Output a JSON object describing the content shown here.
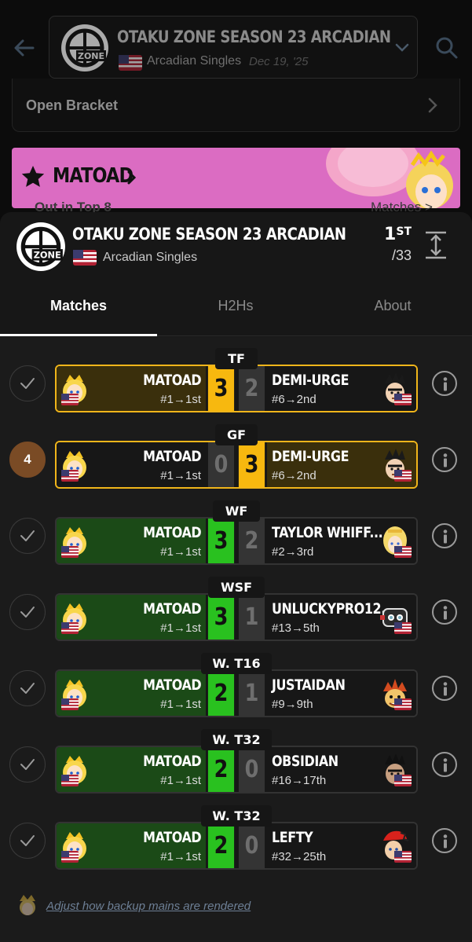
{
  "background_screen": {
    "event_title": "OTAKU ZONE SEASON 23 ARCADIAN",
    "event_subtitle": "Arcadian Singles",
    "event_date": "Dec 19, '25",
    "open_bracket_label": "Open Bracket",
    "player_banner_name": "MATOAD",
    "ghost_left": "Out in Top 8",
    "ghost_right": "Matches >"
  },
  "sheet": {
    "title": "OTAKU ZONE SEASON 23 ARCADIAN",
    "subtitle": "Arcadian Singles",
    "placement": "1",
    "placement_suffix": "ST",
    "placement_total": "/33"
  },
  "tabs": [
    {
      "label": "Matches",
      "active": true
    },
    {
      "label": "H2Hs",
      "active": false
    },
    {
      "label": "About",
      "active": false
    }
  ],
  "matches": [
    {
      "round": "TF",
      "status": "done",
      "left_name": "MATOAD",
      "left_seed": "#1→1st",
      "left_score": "3",
      "right_name": "DEMI-URGE",
      "right_seed": "#6→2nd",
      "right_score": "2",
      "winner": "left",
      "style": "gold"
    },
    {
      "round": "GF",
      "status": "4",
      "left_name": "MATOAD",
      "left_seed": "#1→1st",
      "left_score": "0",
      "right_name": "DEMI-URGE",
      "right_seed": "#6→2nd",
      "right_score": "3",
      "winner": "right",
      "style": "gold"
    },
    {
      "round": "WF",
      "status": "done",
      "left_name": "MATOAD",
      "left_seed": "#1→1st",
      "left_score": "3",
      "right_name": "TAYLOR WHIFF...",
      "right_seed": "#2→3rd",
      "right_score": "2",
      "winner": "left",
      "style": "green"
    },
    {
      "round": "WSF",
      "status": "done",
      "left_name": "MATOAD",
      "left_seed": "#1→1st",
      "left_score": "3",
      "right_name": "UNLUCKYPRO12...",
      "right_seed": "#13→5th",
      "right_score": "1",
      "winner": "left",
      "style": "green"
    },
    {
      "round": "W. T16",
      "status": "done",
      "left_name": "MATOAD",
      "left_seed": "#1→1st",
      "left_score": "2",
      "right_name": "JUSTAIDAN",
      "right_seed": "#9→9th",
      "right_score": "1",
      "winner": "left",
      "style": "green"
    },
    {
      "round": "W. T32",
      "status": "done",
      "left_name": "MATOAD",
      "left_seed": "#1→1st",
      "left_score": "2",
      "right_name": "OBSIDIAN",
      "right_seed": "#16→17th",
      "right_score": "0",
      "winner": "left",
      "style": "green"
    },
    {
      "round": "W. T32",
      "status": "done",
      "left_name": "MATOAD",
      "left_seed": "#1→1st",
      "left_score": "2",
      "right_name": "LEFTY",
      "right_seed": "#32→25th",
      "right_score": "0",
      "winner": "left",
      "style": "green"
    }
  ],
  "footer_link": "Adjust how backup mains are rendered",
  "colors": {
    "win_green": "#29c11f",
    "win_gold": "#f7b80f",
    "banner_pink": "#db6cc2",
    "pending_status": "#7a4b25"
  },
  "icons": [
    "back-arrow-icon",
    "search-icon",
    "chevron-down-icon",
    "star-icon",
    "expand-icon",
    "check-icon",
    "info-icon",
    "us-flag-icon",
    "event-logo-icon",
    "character-icon"
  ]
}
